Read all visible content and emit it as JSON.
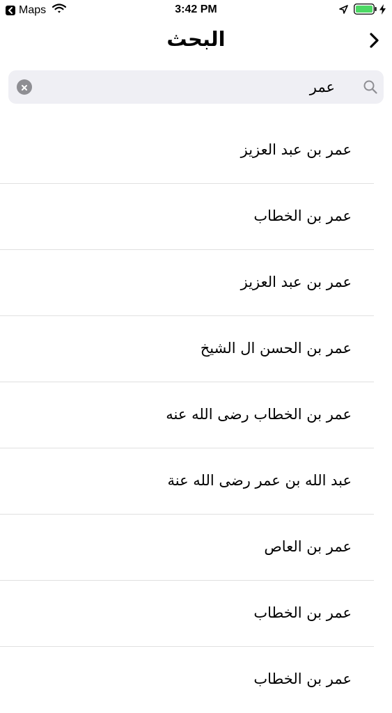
{
  "status_bar": {
    "back_app_label": "Maps",
    "time": "3:42 PM",
    "battery_color": "#4cd964"
  },
  "nav": {
    "title": "البحث",
    "back_icon": "chevron-right-icon"
  },
  "search": {
    "value": "عمر",
    "clear_icon": "clear-icon",
    "search_icon": "magnifier-icon"
  },
  "results": [
    {
      "label": "عمر بن عبد العزيز"
    },
    {
      "label": "عمر بن الخطاب"
    },
    {
      "label": "عمر بن عبد العزيز"
    },
    {
      "label": "عمر بن الحسن ال الشيخ"
    },
    {
      "label": "عمر بن الخطاب رضى الله عنه"
    },
    {
      "label": "عبد الله بن عمر رضى الله عنة"
    },
    {
      "label": "عمر بن العاص"
    },
    {
      "label": "عمر بن الخطاب"
    },
    {
      "label": "عمر بن الخطاب"
    }
  ]
}
